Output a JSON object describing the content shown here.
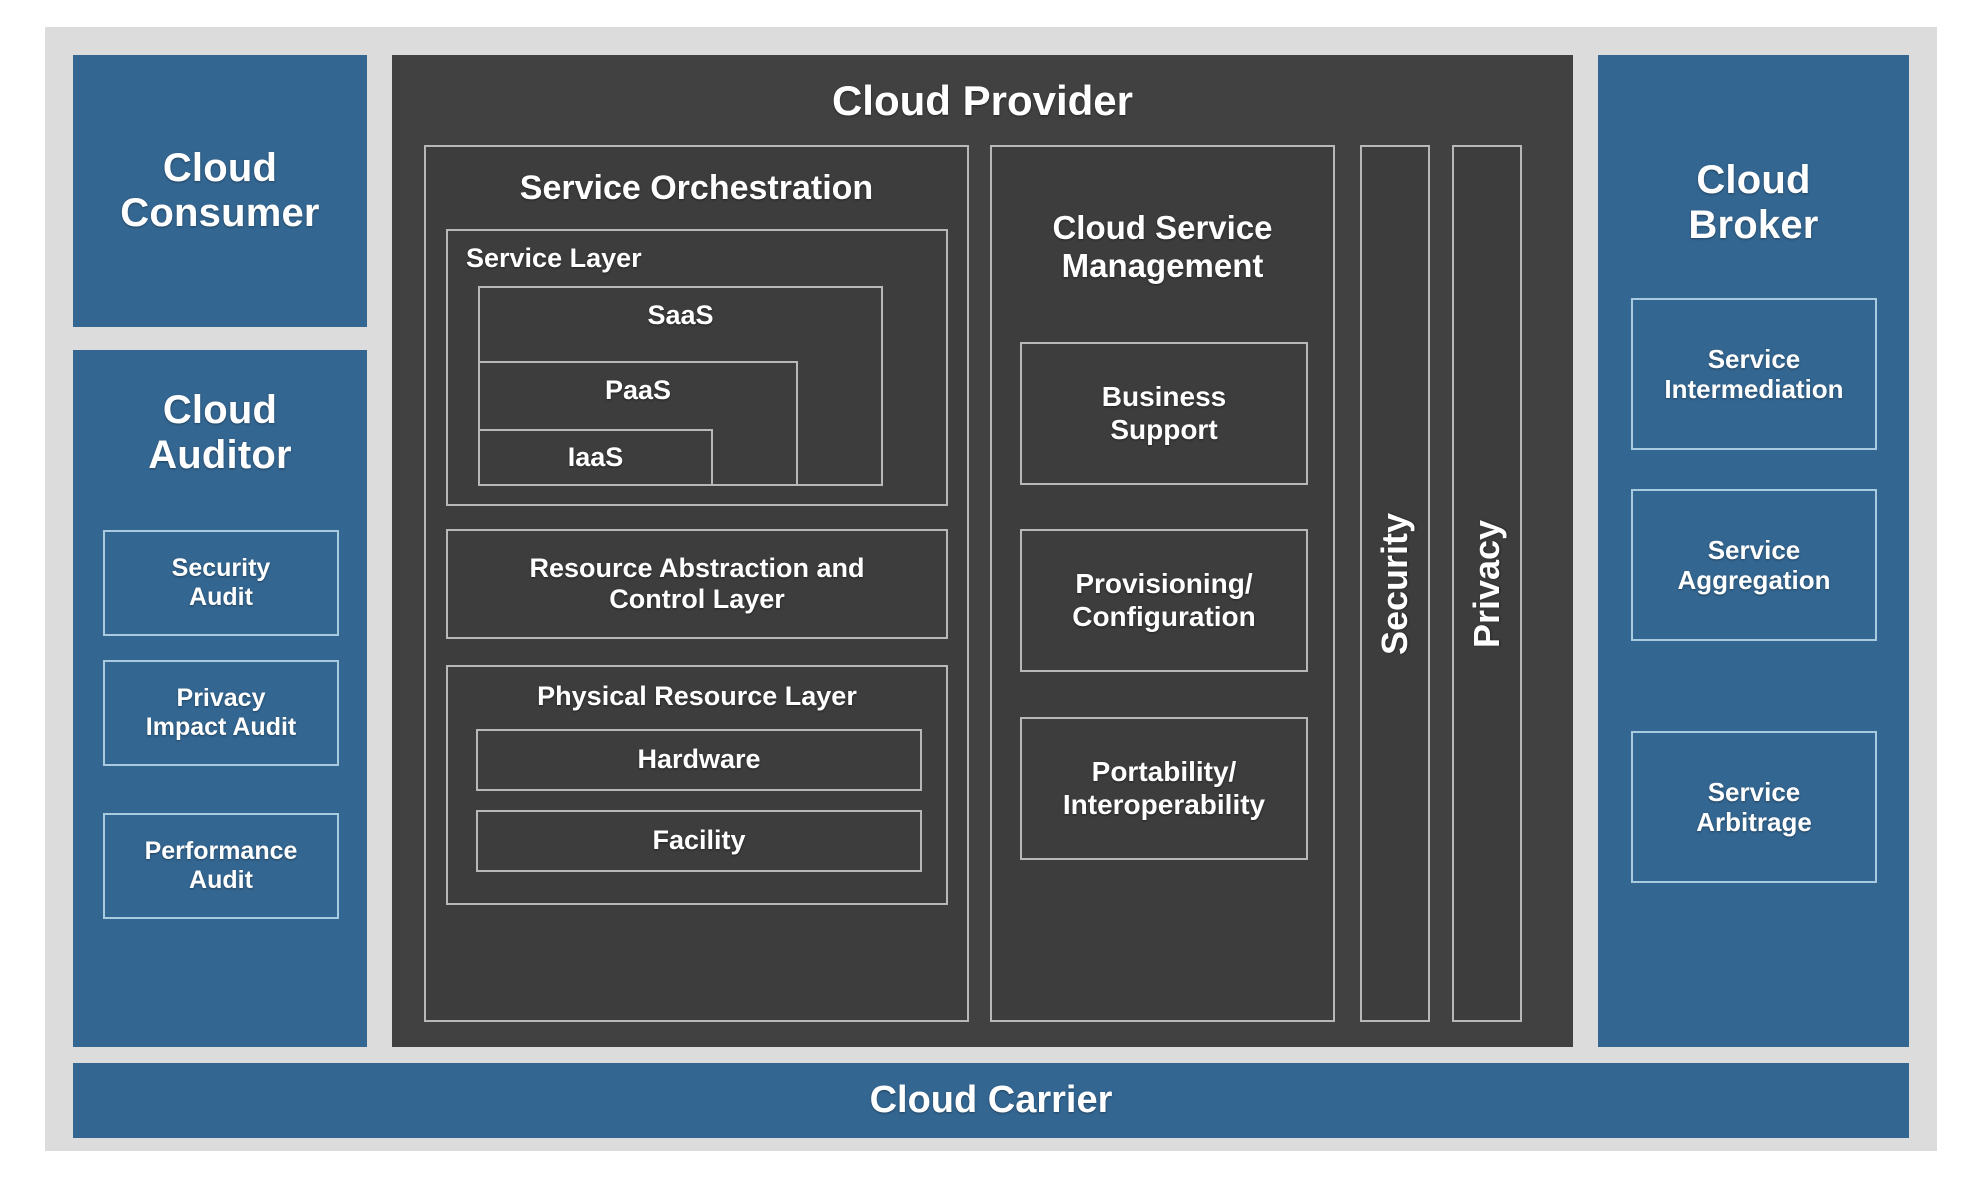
{
  "colors": {
    "blue_panel": "#336691",
    "dark_panel": "#414141",
    "frame_gray": "#dcdcdc",
    "box_outline_light": "#a9cbe0",
    "box_outline_gray": "#b8b8b8",
    "text": "#ffffff"
  },
  "cloud_consumer": {
    "title": "Cloud\nConsumer",
    "title_line1": "Cloud",
    "title_line2": "Consumer"
  },
  "cloud_auditor": {
    "title_line1": "Cloud",
    "title_line2": "Auditor",
    "items": [
      {
        "label_line1": "Security",
        "label_line2": "Audit"
      },
      {
        "label_line1": "Privacy",
        "label_line2": "Impact Audit"
      },
      {
        "label_line1": "Performance",
        "label_line2": "Audit"
      }
    ]
  },
  "cloud_provider": {
    "title": "Cloud Provider",
    "service_orchestration": {
      "title": "Service Orchestration",
      "service_layer": {
        "title": "Service Layer",
        "levels": [
          {
            "label": "SaaS"
          },
          {
            "label": "PaaS"
          },
          {
            "label": "IaaS"
          }
        ]
      },
      "resource_abstraction": {
        "label_line1": "Resource Abstraction and",
        "label_line2": "Control Layer"
      },
      "physical_resource_layer": {
        "title": "Physical Resource Layer",
        "items": [
          {
            "label": "Hardware"
          },
          {
            "label": "Facility"
          }
        ]
      }
    },
    "cloud_service_management": {
      "title_line1": "Cloud Service",
      "title_line2": "Management",
      "items": [
        {
          "label_line1": "Business",
          "label_line2": "Support"
        },
        {
          "label_line1": "Provisioning/",
          "label_line2": "Configuration"
        },
        {
          "label_line1": "Portability/",
          "label_line2": "Interoperability"
        }
      ]
    },
    "security": {
      "label": "Security"
    },
    "privacy": {
      "label": "Privacy"
    }
  },
  "cloud_broker": {
    "title_line1": "Cloud",
    "title_line2": "Broker",
    "items": [
      {
        "label_line1": "Service",
        "label_line2": "Intermediation"
      },
      {
        "label_line1": "Service",
        "label_line2": "Aggregation"
      },
      {
        "label_line1": "Service",
        "label_line2": "Arbitrage"
      }
    ]
  },
  "cloud_carrier": {
    "label": "Cloud Carrier"
  }
}
